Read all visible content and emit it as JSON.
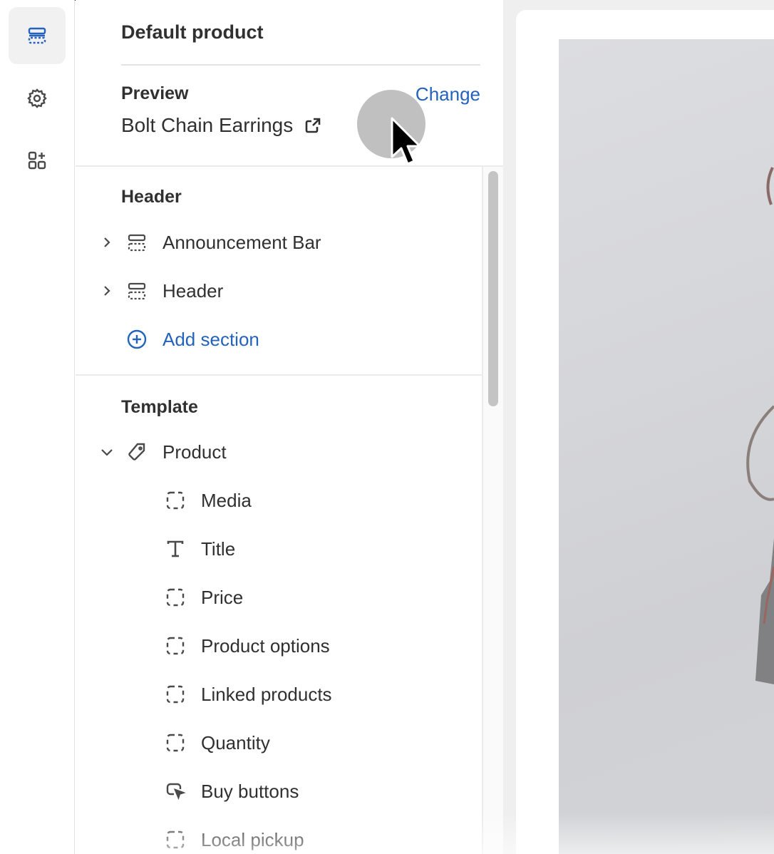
{
  "panel": {
    "title": "Default product",
    "preview_label": "Preview",
    "preview_value": "Bolt Chain Earrings",
    "change_label": "Change"
  },
  "rail": {
    "items": [
      {
        "name": "sections",
        "icon": "sections-icon",
        "active": true
      },
      {
        "name": "settings",
        "icon": "gear-icon",
        "active": false
      },
      {
        "name": "apps",
        "icon": "apps-add-icon",
        "active": false
      }
    ]
  },
  "header_group": {
    "label": "Header",
    "items": [
      {
        "label": "Announcement Bar",
        "icon": "section-layout-icon"
      },
      {
        "label": "Header",
        "icon": "section-layout-icon"
      }
    ],
    "add_label": "Add section"
  },
  "template_group": {
    "label": "Template",
    "section": {
      "label": "Product",
      "icon": "tag-icon"
    },
    "blocks": [
      {
        "label": "Media",
        "icon": "block-dashed-icon"
      },
      {
        "label": "Title",
        "icon": "text-icon"
      },
      {
        "label": "Price",
        "icon": "block-dashed-icon"
      },
      {
        "label": "Product options",
        "icon": "block-dashed-icon"
      },
      {
        "label": "Linked products",
        "icon": "block-dashed-icon"
      },
      {
        "label": "Quantity",
        "icon": "block-dashed-icon"
      },
      {
        "label": "Buy buttons",
        "icon": "cursor-button-icon"
      },
      {
        "label": "Local pickup",
        "icon": "block-dashed-icon"
      }
    ]
  },
  "colors": {
    "accent": "#2463bc",
    "text": "#303030"
  }
}
